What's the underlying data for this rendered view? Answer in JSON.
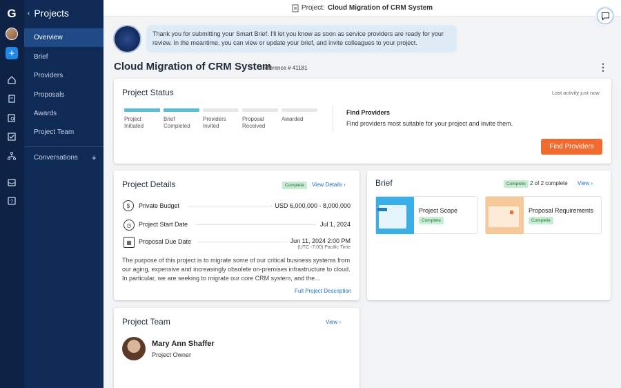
{
  "rail": {
    "logo": "G",
    "plus": "+"
  },
  "sidebar": {
    "title": "Projects",
    "items": [
      {
        "label": "Overview",
        "active": true
      },
      {
        "label": "Brief"
      },
      {
        "label": "Providers"
      },
      {
        "label": "Proposals"
      },
      {
        "label": "Awards"
      },
      {
        "label": "Project Team"
      }
    ],
    "conversations": "Conversations"
  },
  "topbar": {
    "prefix": "Project:",
    "name": "Cloud Migration of CRM System"
  },
  "assistant_message": "Thank you for submitting your Smart Brief. I'll let you know as soon as service providers are ready for your review. In the meantime, you can view or update your brief, and invite colleagues to your project.",
  "project": {
    "title": "Cloud Migration of CRM System",
    "reference": "Reference # 41181"
  },
  "status": {
    "title": "Project Status",
    "last_activity": "Last activity just now",
    "steps": [
      {
        "label": "Project Initiated",
        "done": true
      },
      {
        "label": "Brief Completed",
        "done": true
      },
      {
        "label": "Providers Invited",
        "done": false
      },
      {
        "label": "Proposal Received",
        "done": false
      },
      {
        "label": "Awarded",
        "done": false
      }
    ],
    "find_heading": "Find Providers",
    "find_text": "Find providers most suitable for your project and invite them.",
    "find_button": "Find Providers"
  },
  "details": {
    "title": "Project Details",
    "badge": "Complete",
    "view_link": "View Details",
    "rows": [
      {
        "label": "Private Budget",
        "value": "USD 6,000,000 - 8,000,000"
      },
      {
        "label": "Project Start Date",
        "value": "Jul 1, 2024"
      },
      {
        "label": "Proposal Due Date",
        "value": "Jun 11, 2024 2:00 PM",
        "sub": "(UTC -7:00) Pacific Time"
      }
    ],
    "description": "The purpose of this project is to migrate some of our critical business systems from our aging, expensive and increasingly obsolete on-premises infrastructure to cloud. In particular, we are seeking to migrate our core CRM system, and the…",
    "full_link": "Full Project Description"
  },
  "brief": {
    "title": "Brief",
    "badge": "Complete",
    "count": "2 of 2 complete",
    "view": "View",
    "cards": [
      {
        "title": "Project Scope",
        "badge": "Complete",
        "color": "#3aaee8"
      },
      {
        "title": "Proposal Requirements",
        "badge": "Complete",
        "color": "#f5b07a"
      }
    ]
  },
  "team": {
    "title": "Project Team",
    "view": "View",
    "member_name": "Mary Ann Shaffer",
    "member_role": "Project Owner"
  },
  "colors": {
    "accent": "#f26a2e",
    "sidebar": "#0e2a55",
    "rail": "#0e2245",
    "link": "#1f6fbf"
  }
}
